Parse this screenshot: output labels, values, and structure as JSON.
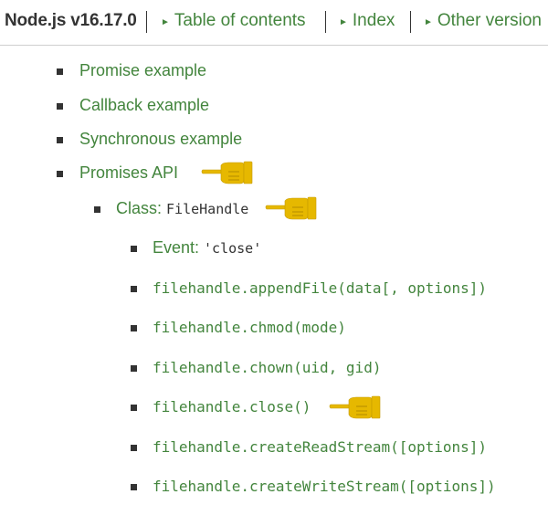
{
  "header": {
    "title": "Node.js v16.17.0",
    "toc_label": "Table of contents",
    "index_label": "Index",
    "other_versions_label": "Other version"
  },
  "toc": {
    "items": [
      {
        "label": "Promise example"
      },
      {
        "label": "Callback example"
      },
      {
        "label": "Synchronous example"
      },
      {
        "label": "Promises API"
      }
    ],
    "class_item": {
      "prefix": "Class: ",
      "code": "FileHandle"
    },
    "event_item": {
      "prefix": "Event: ",
      "code": "'close'"
    },
    "methods": [
      {
        "label": "filehandle.appendFile(data[, options])"
      },
      {
        "label": "filehandle.chmod(mode)"
      },
      {
        "label": "filehandle.chown(uid, gid)"
      },
      {
        "label": "filehandle.close()"
      },
      {
        "label": "filehandle.createReadStream([options])"
      },
      {
        "label": "filehandle.createWriteStream([options])"
      }
    ]
  },
  "icons": {
    "pointer": "pointing-hand-icon",
    "bullet": "square-bullet",
    "nav_arrow": "right-triangle-arrow"
  },
  "colors": {
    "link": "#43853d",
    "text": "#333333",
    "pointer": "#e6b800"
  }
}
